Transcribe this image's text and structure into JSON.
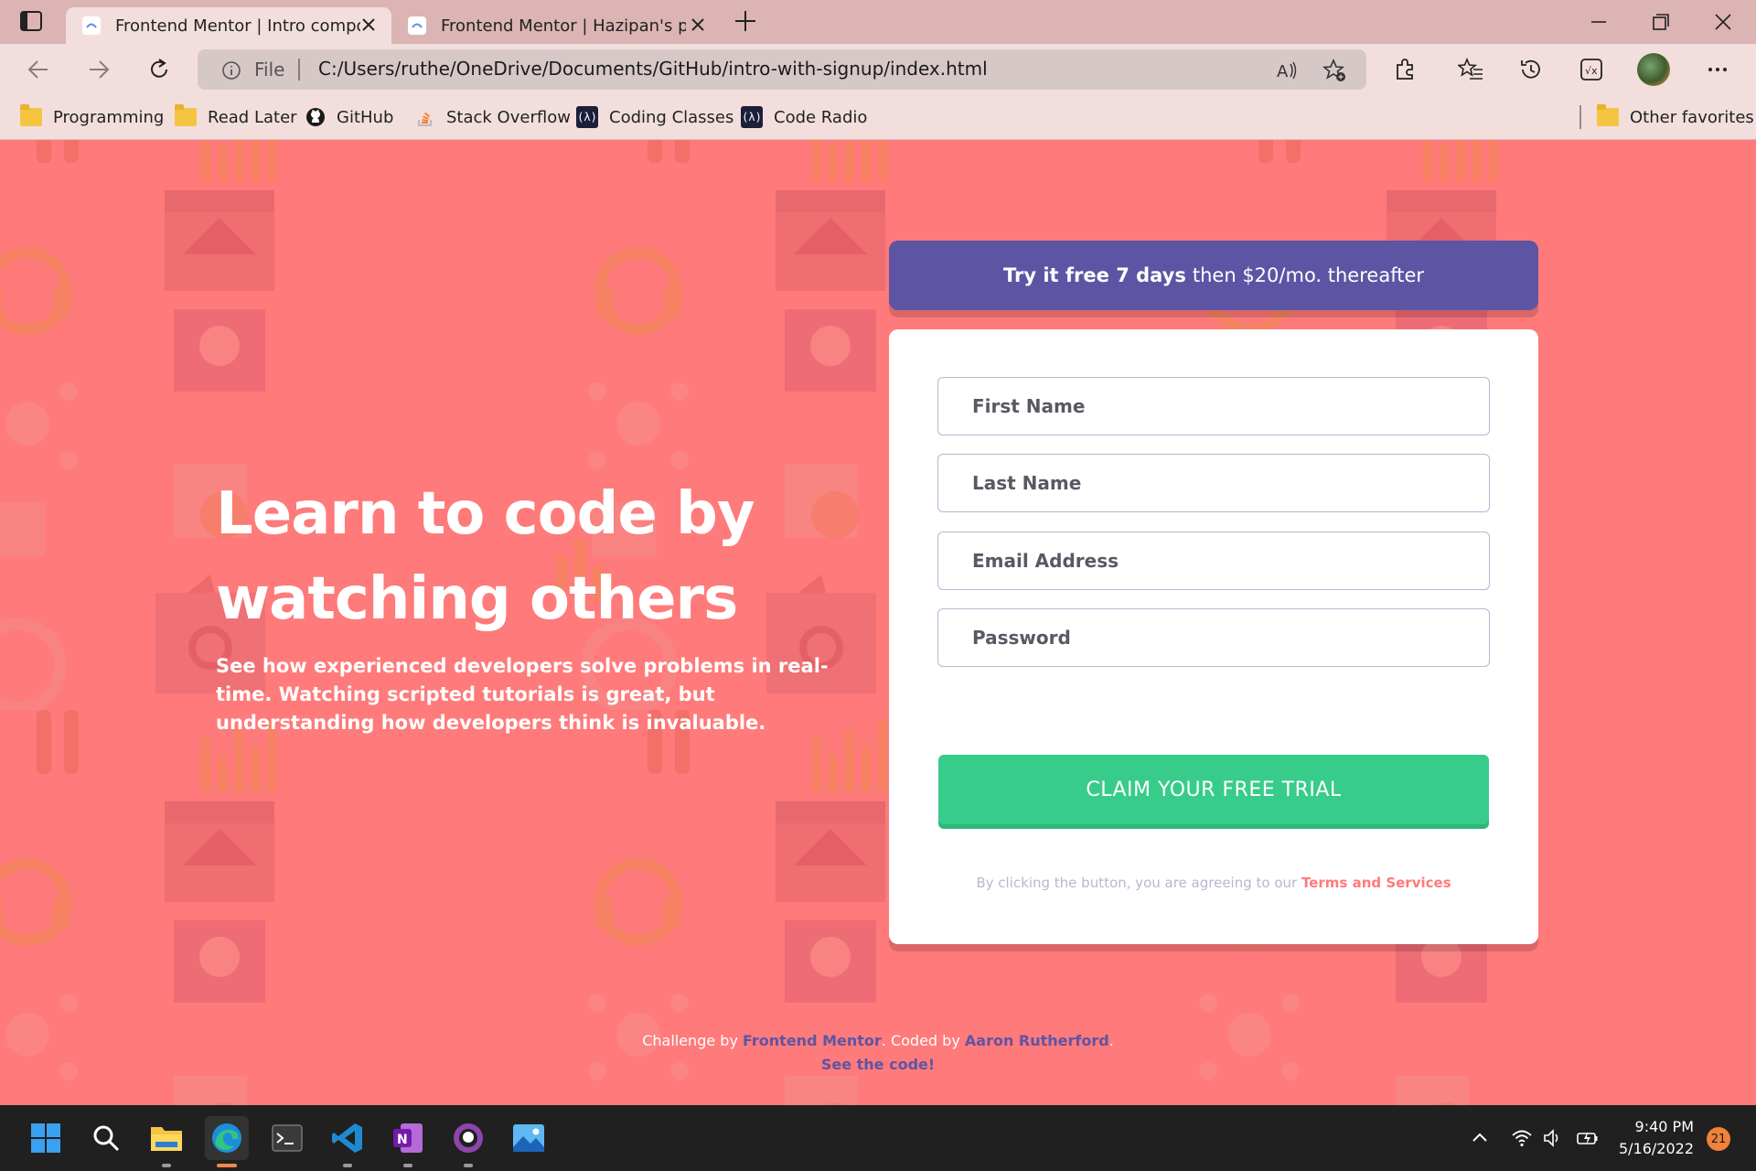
{
  "browser": {
    "tabs": [
      {
        "title": "Frontend Mentor | Intro compon",
        "active": true
      },
      {
        "title": "Frontend Mentor | Hazipan's pro",
        "active": false
      }
    ],
    "address": {
      "scheme_label": "File",
      "url": "C:/Users/ruthe/OneDrive/Documents/GitHub/intro-with-signup/index.html"
    },
    "bookmarks": [
      {
        "label": "Programming",
        "icon": "folder-icon"
      },
      {
        "label": "Read Later",
        "icon": "folder-icon"
      },
      {
        "label": "GitHub",
        "icon": "github-icon"
      },
      {
        "label": "Stack Overflow",
        "icon": "stackoverflow-icon"
      },
      {
        "label": "Coding Classes",
        "icon": "freecodecamp-icon"
      },
      {
        "label": "Code Radio",
        "icon": "freecodecamp-icon"
      }
    ],
    "other_favorites": "Other favorites"
  },
  "hero": {
    "title": "Learn to code by watching others",
    "text": "See how experienced developers solve problems in real-time. Watching scripted tutorials is great, but understanding how developers think is invaluable."
  },
  "promo": {
    "bold": "Try it free 7 days",
    "rest": "then $20/mo. thereafter"
  },
  "form": {
    "first_name_placeholder": "First Name",
    "last_name_placeholder": "Last Name",
    "email_placeholder": "Email Address",
    "password_placeholder": "Password",
    "submit_label": "CLAIM YOUR FREE TRIAL",
    "terms_prefix": "By clicking the button, you are agreeing to our",
    "terms_link": "Terms and Services"
  },
  "attribution": {
    "challenge_by": "Challenge by",
    "frontend_mentor": "Frontend Mentor",
    "coded_by": ". Coded by",
    "author": "Aaron Rutherford",
    "period": ".",
    "see_code": "See the code!"
  },
  "taskbar": {
    "time": "9:40 PM",
    "date": "5/16/2022",
    "notifications": "21"
  },
  "colors": {
    "page_bg": "#ff7a7a",
    "accent_purple": "#5e54a4",
    "cta_green": "#38cc8b",
    "field_border": "#b9b6d3"
  }
}
